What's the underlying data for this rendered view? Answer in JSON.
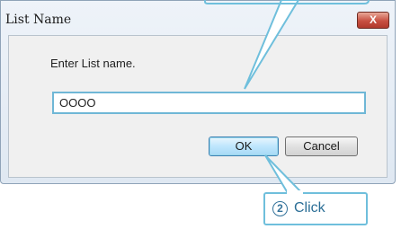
{
  "dialog": {
    "title": "List Name",
    "close_symbol": "X",
    "prompt": "Enter List name.",
    "name_input": {
      "value": "OOOO"
    },
    "ok_label": "OK",
    "cancel_label": "Cancel"
  },
  "callout_step2": {
    "number": "2",
    "label": "Click"
  },
  "colors": {
    "callout_border": "#6fbfdc",
    "callout_text": "#2b6e96",
    "close_button": "#c75041"
  }
}
